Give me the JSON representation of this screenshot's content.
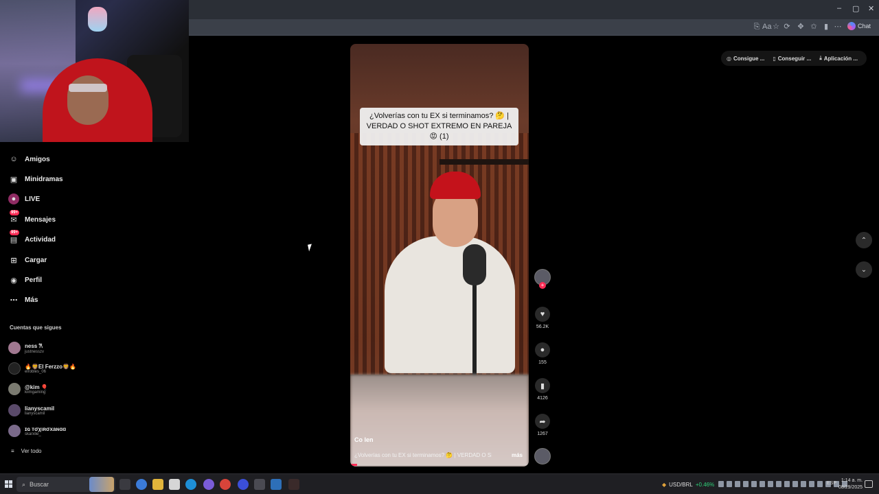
{
  "browser": {
    "window_controls": [
      "–",
      "▢",
      "✕"
    ],
    "toolbar_icons": [
      "translate-icon",
      "reader-icon",
      "star-icon",
      "extension-icon",
      "puzzle-icon",
      "favorites-icon",
      "profile-icon",
      "more-icon"
    ],
    "chat_label": "Chat"
  },
  "sidebar": {
    "items": [
      {
        "label": "Amigos",
        "icon": "friends-icon"
      },
      {
        "label": "Minidramas",
        "icon": "minidramas-icon"
      },
      {
        "label": "LIVE",
        "icon": "live-icon"
      },
      {
        "label": "Mensajes",
        "icon": "messages-icon",
        "badge": "99+"
      },
      {
        "label": "Actividad",
        "icon": "activity-icon",
        "badge": "99+"
      },
      {
        "label": "Cargar",
        "icon": "upload-icon"
      },
      {
        "label": "Perfil",
        "icon": "profile-icon"
      },
      {
        "label": "Más",
        "icon": "more-icon"
      }
    ],
    "following_title": "Cuentas que sigues",
    "following": [
      {
        "name": "ness 𐙚",
        "user": "justnesszv"
      },
      {
        "name": "🔥🦁El Ferzzo🦁🔥",
        "user": "elrobles_06"
      },
      {
        "name": "@kim 🎈",
        "user": "kiimgaming"
      },
      {
        "name": "lianyscamil",
        "user": "lianyscamil"
      },
      {
        "name": "ɪɢ тσχιʀσхаɴɑɑ",
        "user": "skarxlie_"
      }
    ],
    "see_all": "Ver todo"
  },
  "video": {
    "caption_line1": "¿Volverías con tu EX si terminamos? 🤔 |",
    "caption_line2": "VERDAD O SHOT EXTREMO EN PAREJA 😡 (1)",
    "author": "Co len",
    "description": "¿Volverías con tu EX si terminamos? 🤔 | VERDAD O SHOT",
    "more_label": "más",
    "progress": 0.04
  },
  "actions": {
    "likes": "56.2K",
    "comments": "155",
    "saves": "4126",
    "shares": "1267"
  },
  "top_chips": [
    "Consigue ...",
    "Conseguir ...",
    "Aplicación ..."
  ],
  "taskbar": {
    "search_placeholder": "Buscar",
    "ticker": "USD/BRL",
    "ticker_change": "+0.46%",
    "lang": "ESP",
    "time": "1:14 a. m.",
    "date": "08/29/2025"
  }
}
